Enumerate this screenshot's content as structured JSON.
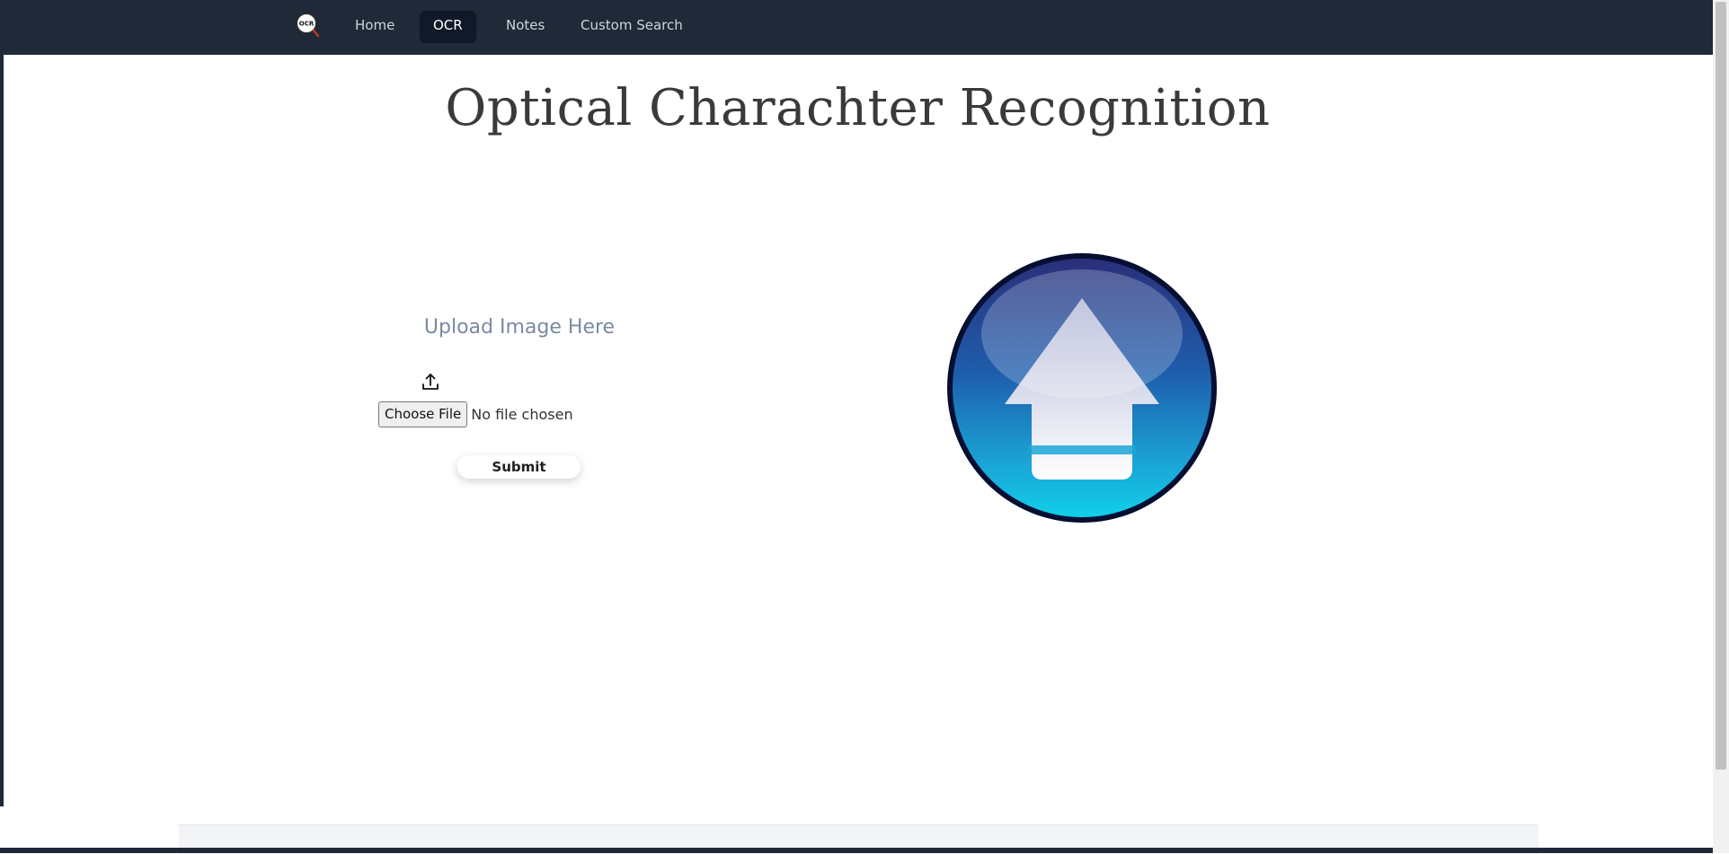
{
  "nav": {
    "logo_text": "OCR",
    "links": [
      "Home",
      "OCR",
      "Notes",
      "Custom Search"
    ],
    "active": "OCR"
  },
  "main": {
    "title": "Optical Charachter Recognition",
    "upload_heading": "Upload Image Here",
    "file_input": {
      "button_label": "Choose File",
      "status": "No file chosen"
    },
    "submit_label": "Submit"
  },
  "icons": {
    "logo": "ocr-magnifier-icon",
    "upload": "upload-icon",
    "graphic": "upload-arrow-circle-icon"
  },
  "colors": {
    "navbar_bg": "#1f2937",
    "active_tab_bg": "#111827",
    "title_text": "#3a3a3a",
    "upload_heading": "#7a8aa3"
  }
}
